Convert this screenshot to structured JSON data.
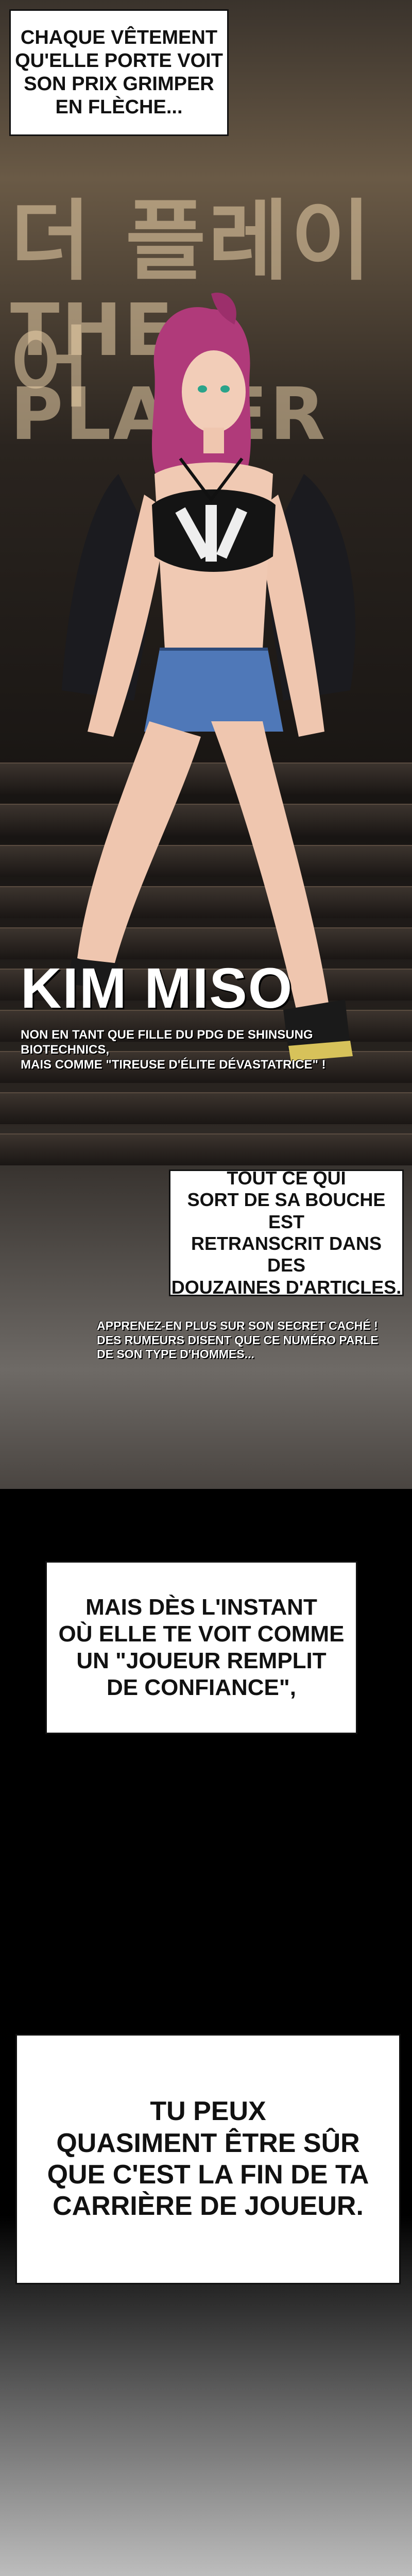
{
  "captions": {
    "top": "CHAQUE VÊTEMENT\nQU'ELLE PORTE VOIT\nSON PRIX GRIMPER\nEN FLÈCHE...",
    "quotes": "TOUT CE QUI\nSORT DE SA BOUCHE EST\nRETRANSCRIT DANS DES\nDOUZAINES D'ARTICLES.",
    "moment": "MAIS DÈS L'INSTANT\nOÙ ELLE TE VOIT COMME\nUN \"JOUEUR REMPLIT\nDE CONFIANCE\",",
    "end": "TU PEUX\nQUASIMENT ÊTRE SÛR\nQUE C'EST LA FIN DE TA\nCARRIÈRE DE JOUEUR."
  },
  "sign": {
    "korean": "더 플레이어",
    "english": "THE PLAYER"
  },
  "character": {
    "name": "KIM MISO",
    "description": "NON EN TANT QUE FILLE DU PDG DE SHINSUNG BIOTECHNICS,\nMAIS COMME \"TIREUSE D'ÉLITE DÉVASTATRICE\" !"
  },
  "secret": "APPRENEZ-EN PLUS SUR SON SECRET CACHÉ !\nDES RUMEURS DISENT QUE CE NUMÉRO PARLE\nDE SON TYPE D'HOMMES..."
}
